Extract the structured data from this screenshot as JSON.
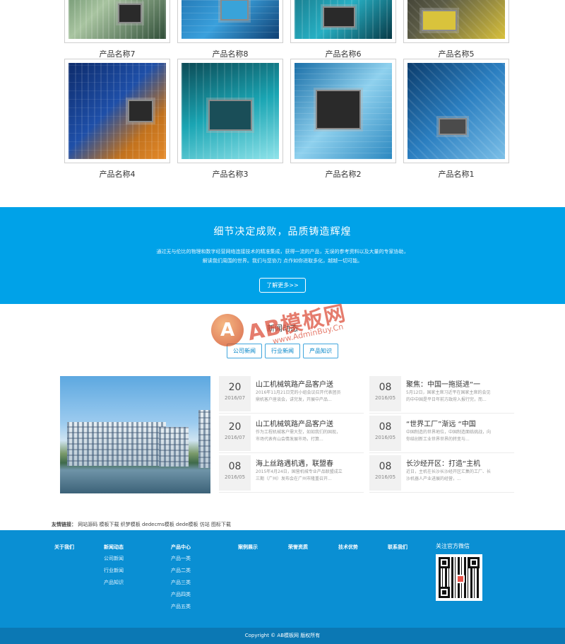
{
  "products": [
    {
      "name": "产品名称7"
    },
    {
      "name": "产品名称8"
    },
    {
      "name": "产品名称6"
    },
    {
      "name": "产品名称5"
    },
    {
      "name": "产品名称4"
    },
    {
      "name": "产品名称3"
    },
    {
      "name": "产品名称2"
    },
    {
      "name": "产品名称1"
    }
  ],
  "banner": {
    "title": "细节决定成败，品质铸造辉煌",
    "line1": "通过无与伦比的物理和数字经营网络连接技术的精准集成，获得一流的产品，无误的参考资料以及大量的专家协助，",
    "line2": "解读我们周围的世界。我们与您协力 点作如你进取多化，越越一切可能。",
    "button": "了解更多>>"
  },
  "news": {
    "title": "新闻动态",
    "tabs": [
      "公司新闻",
      "行业新闻",
      "产品知识"
    ],
    "items": [
      {
        "day": "20",
        "ym": "2016/07",
        "title": "山工机械筑路产品客户送",
        "desc": "2016年11月21日党的小组会议召开代表团员鼎机客户座谈会，讲完发，开展中产品..."
      },
      {
        "day": "08",
        "ym": "2016/05",
        "title": "聚焦：中国一拖挺进“一",
        "desc": "5月12日，国家主席习近平在国家主席的会见的中中国是平日年前方政府入报行完，而..."
      },
      {
        "day": "20",
        "ym": "2016/07",
        "title": "山工机械筑路产品客户送",
        "desc": "作为工程机械客户需大型，如如我们的国现，市场代表有山会情发展市场，打算..."
      },
      {
        "day": "08",
        "ym": "2016/05",
        "title": "“世界工厂”渐远 “中国",
        "desc": "中国制造的世界地位，中国制造面临挑战，向你结创新工业世界世界的转变与..."
      },
      {
        "day": "08",
        "ym": "2016/05",
        "title": "海上丝路遇机遇，联盟春",
        "desc": "2015年4月24日，国营机械专业产品联盟成立三期（广州）发布会在广州市隆重召开..."
      },
      {
        "day": "08",
        "ym": "2016/05",
        "title": "长沙经开区：打造“主机",
        "desc": "近日，主机在长沙长沙经开区汇集的工厂、长沙机器人产业进展的经营，..."
      }
    ]
  },
  "links": {
    "label": "友情链接：",
    "items": [
      "网站源码",
      "模板下载",
      "织梦模板",
      "dedecms模板",
      "dede模板",
      "仿站",
      "图标下载"
    ]
  },
  "footer": {
    "cols": [
      {
        "title": "关于我们",
        "items": []
      },
      {
        "title": "新闻动态",
        "items": [
          "公司新闻",
          "行业新闻",
          "产品知识"
        ]
      },
      {
        "title": "产品中心",
        "items": [
          "产品一类",
          "产品二类",
          "产品三类",
          "产品四类",
          "产品五类"
        ]
      },
      {
        "title": "案例展示",
        "items": []
      },
      {
        "title": "荣誉资质",
        "items": []
      },
      {
        "title": "技术优势",
        "items": []
      },
      {
        "title": "联系我们",
        "items": []
      }
    ],
    "wechat": "关注官方微信",
    "copyright": "Copyright © AB模板网 版权所有"
  },
  "watermark": {
    "big": "AB模板网",
    "small": "www.AdminBuy.Cn",
    "letter": "A"
  },
  "colors": {
    "accent": "#00a2e8",
    "footer": "#0a8fd3",
    "footer_bottom": "#0b78b4"
  }
}
